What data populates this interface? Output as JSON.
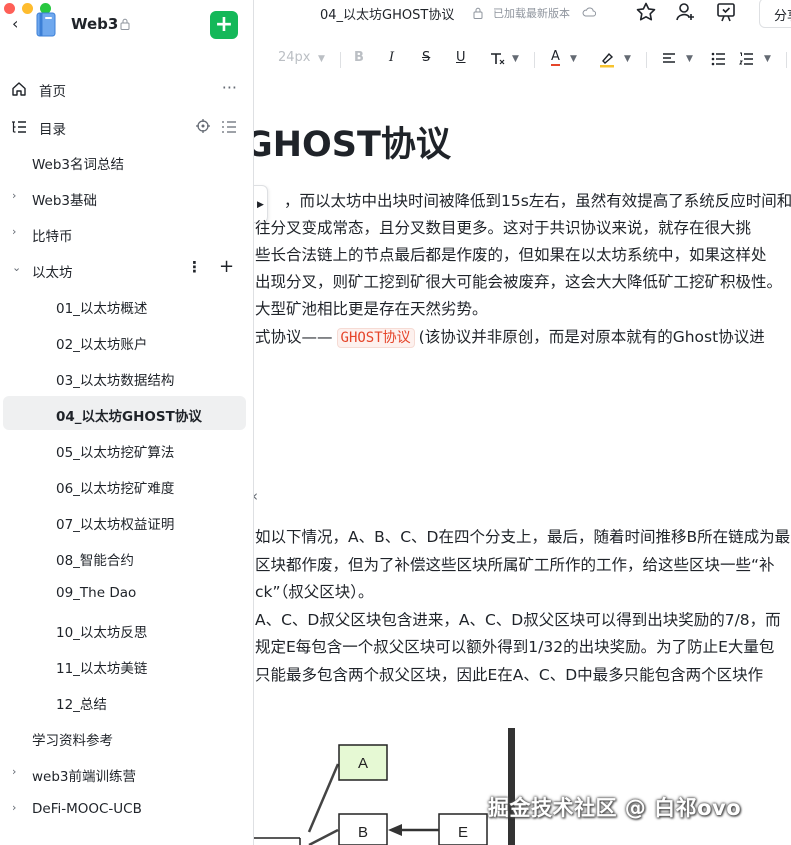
{
  "sidebar": {
    "title": "Web3",
    "nav": {
      "home": "首页",
      "toc": "目录"
    },
    "tree": [
      {
        "label": "Web3名词总结",
        "level": 0,
        "caret": ""
      },
      {
        "label": "Web3基础",
        "level": 0,
        "caret": "›"
      },
      {
        "label": "比特币",
        "level": 0,
        "caret": "›"
      },
      {
        "label": "以太坊",
        "level": 0,
        "caret": "⌄",
        "expanded": true
      },
      {
        "label": "01_以太坊概述",
        "level": 1
      },
      {
        "label": "02_以太坊账户",
        "level": 1
      },
      {
        "label": "03_以太坊数据结构",
        "level": 1
      },
      {
        "label": "04_以太坊GHOST协议",
        "level": 1,
        "active": true
      },
      {
        "label": "05_以太坊挖矿算法",
        "level": 1
      },
      {
        "label": "06_以太坊挖矿难度",
        "level": 1
      },
      {
        "label": "07_以太坊权益证明",
        "level": 1
      },
      {
        "label": "08_智能合约",
        "level": 1
      },
      {
        "label": "09_The Dao",
        "level": 1
      },
      {
        "label": "10_以太坊反思",
        "level": 1
      },
      {
        "label": "11_以太坊美链",
        "level": 1
      },
      {
        "label": "12_总结",
        "level": 1
      },
      {
        "label": "学习资料参考",
        "level": 0,
        "caret": ""
      },
      {
        "label": "web3前端训练营",
        "level": 0,
        "caret": "›"
      },
      {
        "label": "DeFi-MOOC-UCB",
        "level": 0,
        "caret": "›"
      }
    ]
  },
  "topbar": {
    "doc_title": "04_以太坊GHOST协议",
    "save_status": "已加载最新版本",
    "share_label": "分享"
  },
  "toolbar": {
    "font_size": "24px",
    "bold": "B",
    "italic": "I",
    "strike": "S",
    "underline": "U",
    "text_color": "A"
  },
  "content": {
    "heading": "GHOST协议",
    "lines": [
      "，而以太坊中出块时间被降低到15s左右，虽然有效提高了系统反应时间和",
      "往分叉变成常态，且分叉数目更多。这对于共识协议来说，就存在很大挑",
      "些长合法链上的节点最后都是作废的，但如果在以太坊系统中，如果这样处",
      "出现分叉，则矿工挖到矿很大可能会被废弃，这会大大降低矿工挖矿积极性。",
      "大型矿池相比更是存在天然劣势。"
    ],
    "line6_prefix": "式协议——",
    "line6_code": "GHOST协议",
    "line6_suffix": "(该协议并非原创，而是对原本就有的Ghost协议进",
    "section_mark": "‹",
    "lines2": [
      "如以下情况，A、B、C、D在四个分支上，最后，随着时间推移B所在链成为最",
      "区块都作废，但为了补偿这些区块所属矿工所作的工作，给这些区块一些“补",
      "ck”（叔父区块）。",
      "A、C、D叔父区块包含进来，A、C、D叔父区块可以得到出块奖励的7/8，而",
      "规定E每包含一个叔父区块可以额外得到1/32的出块奖励。为了防止E大量包",
      "只能最多包含两个叔父区块，因此E在A、C、D中最多只能包含两个区块作"
    ]
  },
  "diagram": {
    "nodes": [
      "A",
      "B",
      "E"
    ],
    "node_a_color": "#e6f9d4"
  },
  "watermark": "掘金技术社区 @ 白祁ovo",
  "colors": {
    "accent_green": "#14b859",
    "code_red": "#e5452a",
    "highlight_bg": "#eff0f1"
  }
}
